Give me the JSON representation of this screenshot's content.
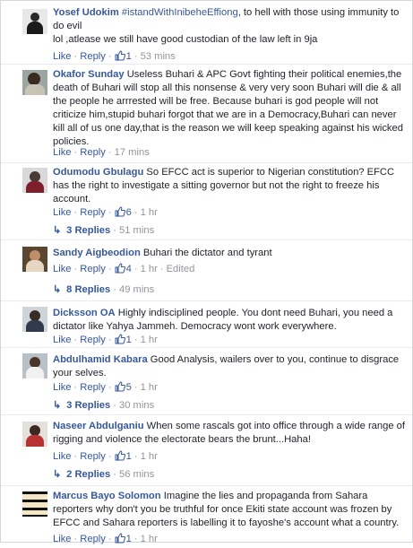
{
  "comments": [
    {
      "name": "Yosef Udokim",
      "tag": "#istandWithInibeheEffiong",
      "text": ", to hell with those using immunity to do evil",
      "text2": "lol ,atlease we still have good custodian of the law left in 9ja",
      "like": "Like",
      "reply": "Reply",
      "likes": "1",
      "time": "53 mins"
    },
    {
      "name": "Okafor Sunday",
      "text": "Useless Buhari & APC Govt fighting their political enemies,the death of Buhari will stop all this nonsense & very very soon Buhari will die & all the people he arrrested will be free. Because buhari is god people will not criticize him,stupid buhari forgot that we are in a Democracy,Buhari can never kill all of us one day,that is the reason we will keep speaking against his wicked policies.",
      "like": "Like",
      "reply": "Reply",
      "time": "17 mins"
    },
    {
      "name": "Odumodu Gbulagu",
      "text": "So EFCC act is superior to Nigerian constitution? EFCC has the right to investigate a sitting governor but not the right to freeze his account.",
      "like": "Like",
      "reply": "Reply",
      "likes": "6",
      "time": "1 hr",
      "replies": "3 Replies",
      "replies_time": "51 mins"
    },
    {
      "name": "Sandy Aigbeodion",
      "text": "Buhari the dictator and tyrant",
      "like": "Like",
      "reply": "Reply",
      "likes": "4",
      "time": "1 hr",
      "edited": "Edited",
      "replies": "8 Replies",
      "replies_time": "49 mins"
    },
    {
      "name": "Dicksson OA",
      "text": "Highly indisciplined people. You dont need Buhari, you need a dictator like Yahya Jammeh. Democracy wont work everywhere.",
      "like": "Like",
      "reply": "Reply",
      "likes": "1",
      "time": "1 hr"
    },
    {
      "name": "Abdulhamid Kabara",
      "text": "Good Analysis, wailers over to you, continue to disgrace your selves.",
      "like": "Like",
      "reply": "Reply",
      "likes": "5",
      "time": "1 hr",
      "replies": "3 Replies",
      "replies_time": "30 mins"
    },
    {
      "name": "Naseer Abdulganiu",
      "text": "When some rascals got into office through a wide range of rigging and violence the electorate bears the brunt...Haha!",
      "like": "Like",
      "reply": "Reply",
      "likes": "1",
      "time": "1 hr",
      "replies": "2 Replies",
      "replies_time": "56 mins"
    },
    {
      "name": "Marcus Bayo Solomon",
      "text": "Imagine the lies and propaganda from Sahara reporters why don't you be truthful for once Ekiti state account was frozen by EFCC and Sahara reporters is labelling it to fayoshe's account what a country.",
      "like": "Like",
      "reply": "Reply",
      "likes": "1",
      "time": "1 hr"
    }
  ],
  "colors": {
    "link": "#365899",
    "meta": "#90949c",
    "text": "#1d2129"
  },
  "icons": {
    "like_count": "thumbs-up-icon",
    "reply_arrow": "reply-arrow-icon"
  }
}
